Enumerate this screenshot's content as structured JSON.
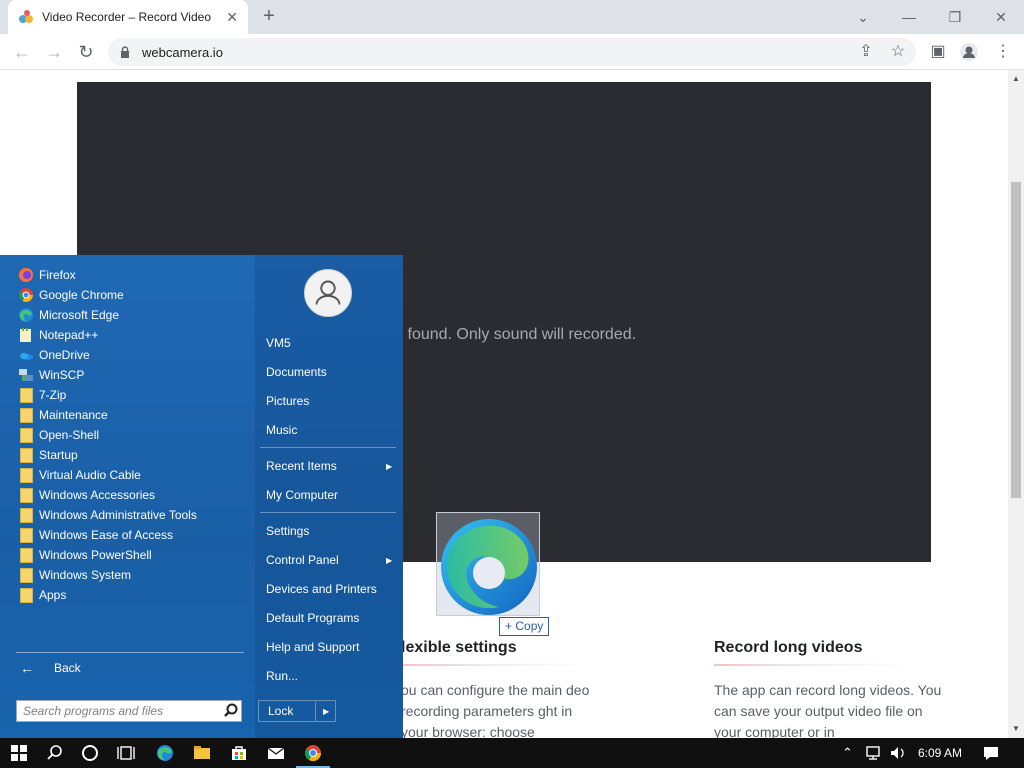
{
  "browser": {
    "tab_title": "Video Recorder – Record Video",
    "tab_close": "✕",
    "new_tab": "+",
    "url": "webcamera.io",
    "window_min": "—",
    "window_restore": "❐",
    "window_close": "✕",
    "tab_search": "⌄"
  },
  "page": {
    "video_message": "eras found. Only sound will recorded.",
    "feature1": {
      "title": "lexible settings",
      "text": "ou can configure the main deo recording parameters ght in your browser: choose"
    },
    "feature2": {
      "title": "Record long videos",
      "text": "The app can record long videos. You can save your output video file on your computer or in"
    }
  },
  "drag": {
    "copy_label": "Copy",
    "copy_plus": "+"
  },
  "start_menu": {
    "apps": [
      {
        "label": "Firefox",
        "icon": "firefox-icon"
      },
      {
        "label": "Google Chrome",
        "icon": "chrome-icon"
      },
      {
        "label": "Microsoft Edge",
        "icon": "edge-icon"
      },
      {
        "label": "Notepad++",
        "icon": "notepadpp-icon"
      },
      {
        "label": "OneDrive",
        "icon": "onedrive-icon"
      },
      {
        "label": "WinSCP",
        "icon": "winscp-icon"
      },
      {
        "label": "7-Zip",
        "icon": "folder-icon"
      },
      {
        "label": "Maintenance",
        "icon": "folder-icon"
      },
      {
        "label": "Open-Shell",
        "icon": "folder-icon"
      },
      {
        "label": "Startup",
        "icon": "folder-icon"
      },
      {
        "label": "Virtual Audio Cable",
        "icon": "folder-icon"
      },
      {
        "label": "Windows Accessories",
        "icon": "folder-icon"
      },
      {
        "label": "Windows Administrative Tools",
        "icon": "folder-icon"
      },
      {
        "label": "Windows Ease of Access",
        "icon": "folder-icon"
      },
      {
        "label": "Windows PowerShell",
        "icon": "folder-icon"
      },
      {
        "label": "Windows System",
        "icon": "folder-icon"
      },
      {
        "label": "Apps",
        "icon": "folder-icon"
      }
    ],
    "back_label": "Back",
    "search_placeholder": "Search programs and files",
    "right": {
      "user": "VM5",
      "documents": "Documents",
      "pictures": "Pictures",
      "music": "Music",
      "recent_items": "Recent Items",
      "my_computer": "My Computer",
      "settings": "Settings",
      "control_panel": "Control Panel",
      "devices_printers": "Devices and Printers",
      "default_programs": "Default Programs",
      "help_support": "Help and Support",
      "run": "Run...",
      "lock": "Lock"
    }
  },
  "taskbar": {
    "time": "6:09 AM"
  },
  "colors": {
    "startmenu_blue": "#1f68b4",
    "video_bg": "#2b2c31",
    "taskbar": "#101010"
  }
}
